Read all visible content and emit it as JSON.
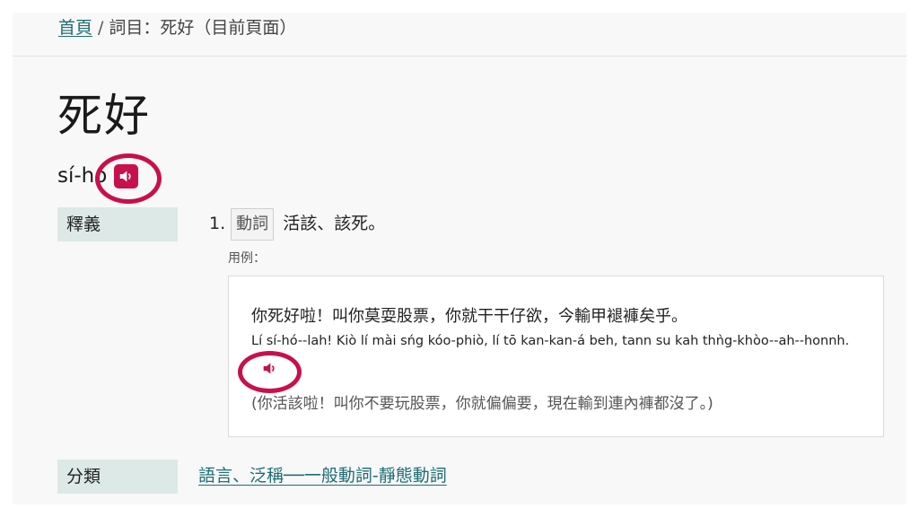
{
  "breadcrumb": {
    "home": "首頁",
    "separator": "/",
    "current": "詞目：死好（目前頁面）"
  },
  "entry": {
    "headword": "死好",
    "romanization": "sí-hó",
    "audio_icon": "speaker-icon"
  },
  "definition": {
    "label": "釋義",
    "senses": [
      {
        "number": "1.",
        "part_of_speech": "動詞",
        "text": "活該、該死。",
        "example_label": "用例：",
        "example": {
          "han": "你死好啦！叫你莫耍股票，你就干干仔欲，今輸甲褪褲矣乎。",
          "romanization": "Lí sí-hó--lah! Kiò lí mài sńg kóo-phiò, lí tō kan-kan-á beh, tann su kah thǹg-khòo--ah--honnh.",
          "translation": "(你活該啦！叫你不要玩股票，你就偏偏要，現在輸到連內褲都沒了。)"
        }
      }
    ]
  },
  "category": {
    "label": "分類",
    "link": "語言、泛稱──一般動詞-靜態動詞"
  },
  "colors": {
    "accent": "#c8104b",
    "link": "#1d6e74",
    "label_bg": "#dde9e6"
  }
}
